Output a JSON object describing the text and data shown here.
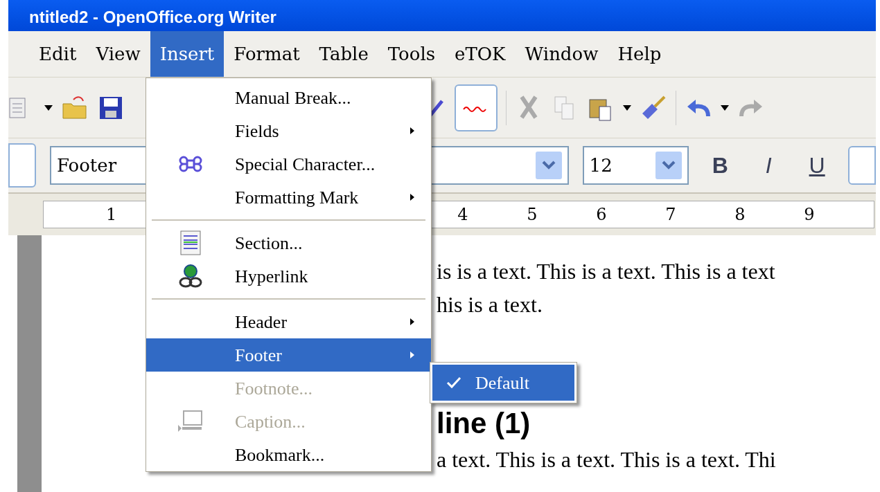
{
  "window": {
    "title": "ntitled2 - OpenOffice.org Writer"
  },
  "menubar": [
    {
      "label": "Edit",
      "selected": false
    },
    {
      "label": "View",
      "selected": false
    },
    {
      "label": "Insert",
      "selected": true
    },
    {
      "label": "Format",
      "selected": false
    },
    {
      "label": "Table",
      "selected": false
    },
    {
      "label": "Tools",
      "selected": false
    },
    {
      "label": "eTOK",
      "selected": false
    },
    {
      "label": "Window",
      "selected": false
    },
    {
      "label": "Help",
      "selected": false
    }
  ],
  "formatting_bar": {
    "paragraph_style": "Footer",
    "font_size": "12",
    "buttons": [
      "B",
      "I",
      "U"
    ]
  },
  "ruler": {
    "left_numbers": [
      "1"
    ],
    "right_numbers": [
      "4",
      "5",
      "6",
      "7",
      "8",
      "9"
    ]
  },
  "document": {
    "lines_top": [
      "is is a text. This is a text. This is a text",
      "his is a text."
    ],
    "heading": "line (1)",
    "lines_bottom": [
      "a text. This is a text. This is a text. Thi"
    ]
  },
  "insert_menu": [
    {
      "kind": "item",
      "label": "Manual Break...",
      "submenu": false,
      "disabled": false,
      "selected": false
    },
    {
      "kind": "item",
      "label": "Fields",
      "submenu": true,
      "disabled": false,
      "selected": false
    },
    {
      "kind": "item",
      "label": "Special Character...",
      "submenu": false,
      "disabled": false,
      "selected": false
    },
    {
      "kind": "item",
      "label": "Formatting Mark",
      "submenu": true,
      "disabled": false,
      "selected": false
    },
    {
      "kind": "separator"
    },
    {
      "kind": "item",
      "label": "Section...",
      "submenu": false,
      "disabled": false,
      "selected": false
    },
    {
      "kind": "item",
      "label": "Hyperlink",
      "submenu": false,
      "disabled": false,
      "selected": false
    },
    {
      "kind": "separator"
    },
    {
      "kind": "item",
      "label": "Header",
      "submenu": true,
      "disabled": false,
      "selected": false
    },
    {
      "kind": "item",
      "label": "Footer",
      "submenu": true,
      "disabled": false,
      "selected": true
    },
    {
      "kind": "item",
      "label": "Footnote...",
      "submenu": false,
      "disabled": true,
      "selected": false
    },
    {
      "kind": "item",
      "label": "Caption...",
      "submenu": false,
      "disabled": true,
      "selected": false
    },
    {
      "kind": "item",
      "label": "Bookmark...",
      "submenu": false,
      "disabled": false,
      "selected": false
    }
  ],
  "footer_submenu": [
    {
      "label": "Default",
      "checked": true,
      "selected": true
    }
  ]
}
